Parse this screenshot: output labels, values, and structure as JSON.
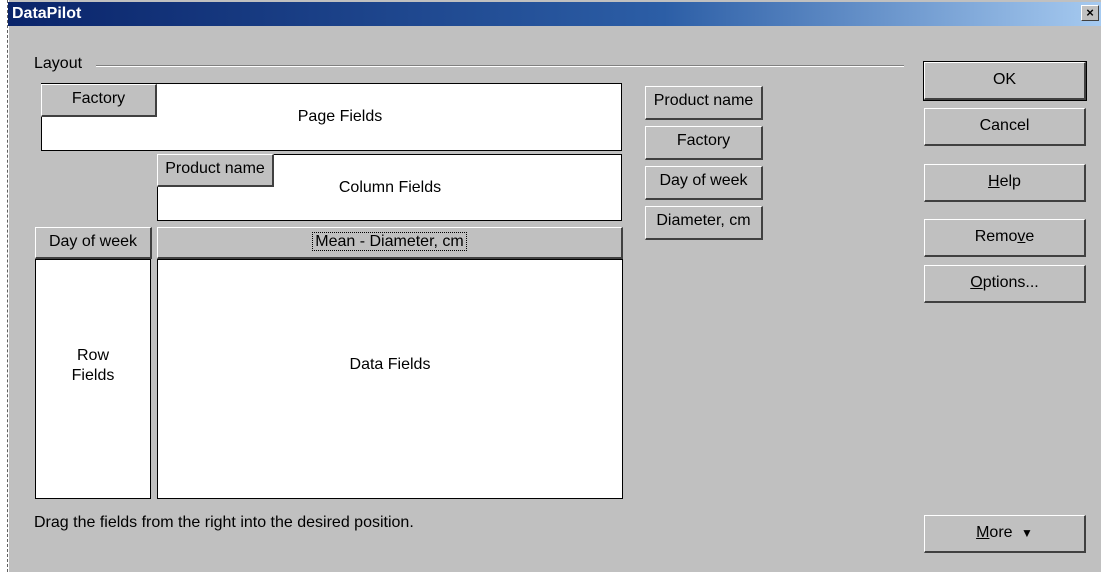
{
  "window": {
    "title": "DataPilot",
    "close_label": "×"
  },
  "layout": {
    "group_label": "Layout",
    "page_fields_label": "Page Fields",
    "column_fields_label": "Column Fields",
    "row_fields_label_line1": "Row",
    "row_fields_label_line2": "Fields",
    "data_fields_label": "Data Fields",
    "page_field_button": "Factory",
    "column_field_button": "Product name",
    "row_field_button": "Day of week",
    "data_field_button": "Mean - Diameter, cm"
  },
  "available_fields": [
    "Product name",
    "Factory",
    "Day of week",
    "Diameter, cm"
  ],
  "buttons": {
    "ok": "OK",
    "cancel": "Cancel",
    "help": "Help",
    "remove": "Remove",
    "options": "Options...",
    "more": "More",
    "more_icon": "double-chevron-down-icon"
  },
  "hint_text": "Drag the fields from the right into the desired position."
}
